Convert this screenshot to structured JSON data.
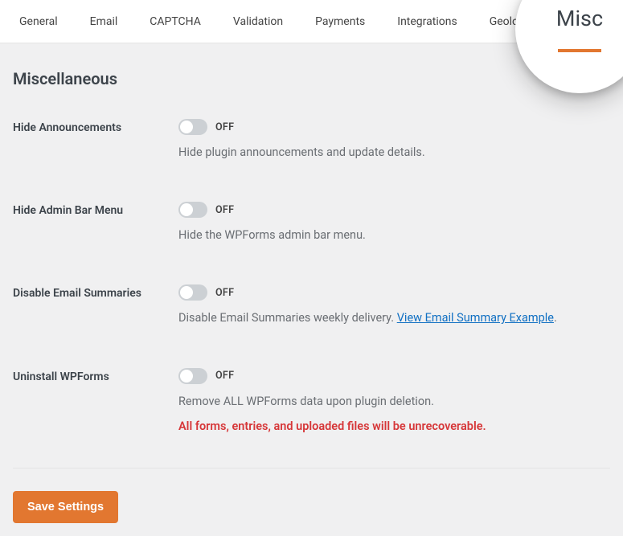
{
  "tabs": {
    "general": "General",
    "email": "Email",
    "captcha": "CAPTCHA",
    "validation": "Validation",
    "payments": "Payments",
    "integrations": "Integrations",
    "geolocation": "Geolocation"
  },
  "bubble": {
    "label": "Misc"
  },
  "page": {
    "title": "Miscellaneous"
  },
  "state": {
    "off": "OFF"
  },
  "settings": {
    "hide_ann": {
      "label": "Hide Announcements",
      "desc": "Hide plugin announcements and update details."
    },
    "hide_admin": {
      "label": "Hide Admin Bar Menu",
      "desc": "Hide the WPForms admin bar menu."
    },
    "email_sum": {
      "label": "Disable Email Summaries",
      "desc_pre": "Disable Email Summaries weekly delivery. ",
      "link": "View Email Summary Example",
      "desc_post": "."
    },
    "uninstall": {
      "label": "Uninstall WPForms",
      "desc": "Remove ALL WPForms data upon plugin deletion.",
      "warn": "All forms, entries, and uploaded files will be unrecoverable."
    }
  },
  "buttons": {
    "save": "Save Settings"
  }
}
